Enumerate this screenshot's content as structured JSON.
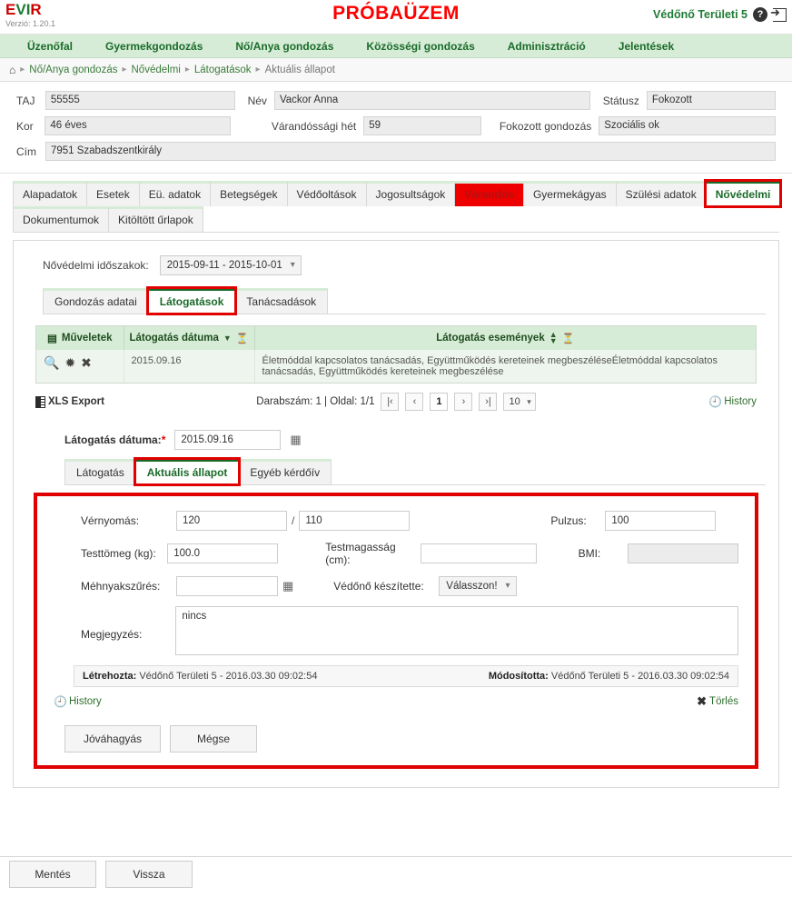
{
  "header": {
    "logo": "EVIR",
    "version": "Verzió: 1.20.1",
    "banner": "PRÓBAÜZEM",
    "user": "Védőnő Területi 5",
    "help_icon": "?",
    "logout_icon": "logout"
  },
  "mainnav": {
    "items": [
      {
        "label": "Üzenőfal"
      },
      {
        "label": "Gyermekgondozás"
      },
      {
        "label": "Nő/Anya gondozás"
      },
      {
        "label": "Közösségi gondozás"
      },
      {
        "label": "Adminisztráció"
      },
      {
        "label": "Jelentések"
      }
    ]
  },
  "breadcrumb": {
    "home": "⌂",
    "items": [
      "Nő/Anya gondozás",
      "Nővédelmi",
      "Látogatások",
      "Aktuális állapot"
    ]
  },
  "patient": {
    "taj_label": "TAJ",
    "taj_value": "55555",
    "nev_label": "Név",
    "nev_value": "Vackor Anna",
    "statusz_label": "Státusz",
    "statusz_value": "Fokozott",
    "kor_label": "Kor",
    "kor_value": "46 éves",
    "varandossagi_label": "Várandóssági hét",
    "varandossagi_value": "59",
    "fokozott_label": "Fokozott gondozás",
    "fokozott_value": "Szociális ok",
    "cim_label": "Cím",
    "cim_value": "7951 Szabadszentkirály"
  },
  "tabs": {
    "row1": [
      {
        "label": "Alapadatok",
        "state": "normal"
      },
      {
        "label": "Esetek",
        "state": "normal"
      },
      {
        "label": "Eü. adatok",
        "state": "normal"
      },
      {
        "label": "Betegségek",
        "state": "normal"
      },
      {
        "label": "Védőoltások",
        "state": "normal"
      },
      {
        "label": "Jogosultságok",
        "state": "normal"
      },
      {
        "label": "Várandós",
        "state": "red-fill"
      },
      {
        "label": "Gyermekágyas",
        "state": "normal"
      },
      {
        "label": "Szülési adatok",
        "state": "normal"
      },
      {
        "label": "Nővédelmi",
        "state": "red-box"
      }
    ],
    "row2": [
      {
        "label": "Dokumentumok",
        "state": "normal"
      },
      {
        "label": "Kitöltött űrlapok",
        "state": "normal"
      }
    ]
  },
  "period": {
    "label": "Nővédelmi időszakok:",
    "value": "2015-09-11 - 2015-10-01"
  },
  "subtabs": [
    {
      "label": "Gondozás adatai",
      "state": "normal"
    },
    {
      "label": "Látogatások",
      "state": "red-box"
    },
    {
      "label": "Tanácsadások",
      "state": "normal"
    }
  ],
  "grid": {
    "columns": [
      "Műveletek",
      "Látogatás dátuma",
      "Látogatás eseményei"
    ],
    "col_actions_icon": "columns-icon",
    "header_icons": {
      "date_sort": "▼",
      "date_filter": "filter-icon",
      "events_sort": "▲▼",
      "events_filter": "filter-icon"
    },
    "column_headers_display": [
      "Műveletek",
      "Látogatás dátuma",
      "Látogatás események"
    ],
    "rows": [
      {
        "actions": [
          "view-icon",
          "edit-icon",
          "delete-icon"
        ],
        "date": "2015.09.16",
        "events": "Életmóddal kapcsolatos tanácsadás, Együttműködés kereteinek megbeszéléseÉletmóddal kapcsolatos tanácsadás, Együttműködés kereteinek megbeszélése"
      }
    ]
  },
  "pager": {
    "xls_label": "XLS Export",
    "count_label": "Darabszám: 1 | Oldal: 1/1",
    "first": "|‹",
    "prev": "‹",
    "current": "1",
    "next": "›",
    "last": "›|",
    "pagesize": "10",
    "history_label": "History"
  },
  "visit_date": {
    "label": "Látogatás dátuma:",
    "required": "*",
    "value": "2015.09.16",
    "calendar_icon": "calendar-icon"
  },
  "inner_tabs": [
    {
      "label": "Látogatás",
      "state": "normal"
    },
    {
      "label": "Aktuális állapot",
      "state": "red-box"
    },
    {
      "label": "Egyéb kérdőív",
      "state": "normal"
    }
  ],
  "form": {
    "vernyomas_label": "Vérnyomás:",
    "vernyomas_sys": "120",
    "vernyomas_sep": "/",
    "vernyomas_dia": "110",
    "pulzus_label": "Pulzus:",
    "pulzus_value": "100",
    "testtomeg_label": "Testtömeg (kg):",
    "testtomeg_value": "100.0",
    "testmagassag_label": "Testmagasság (cm):",
    "testmagassag_value": "",
    "bmi_label": "BMI:",
    "bmi_value": "",
    "mehnyak_label": "Méhnyakszűrés:",
    "mehnyak_value": "",
    "mehnyak_icon": "calendar-icon",
    "vedono_label": "Védőnő készítette:",
    "vedono_value": "Válasszon!",
    "megjegyzes_label": "Megjegyzés:",
    "megjegyzes_value": "nincs"
  },
  "meta": {
    "created_label": "Létrehozta:",
    "created_value": "Védőnő Területi 5 - 2016.03.30 09:02:54",
    "modified_label": "Módosította:",
    "modified_value": "Védőnő Területi 5 - 2016.03.30 09:02:54",
    "history_label": "History",
    "delete_label": "Törlés"
  },
  "form_buttons": {
    "approve": "Jóváhagyás",
    "cancel": "Mégse"
  },
  "footer_buttons": {
    "save": "Mentés",
    "back": "Vissza"
  },
  "colors": {
    "brand_green": "#1a6b2a",
    "nav_bg": "#d6ecd6",
    "alert_red": "#ff0000",
    "annotation_red": "#e00000"
  }
}
